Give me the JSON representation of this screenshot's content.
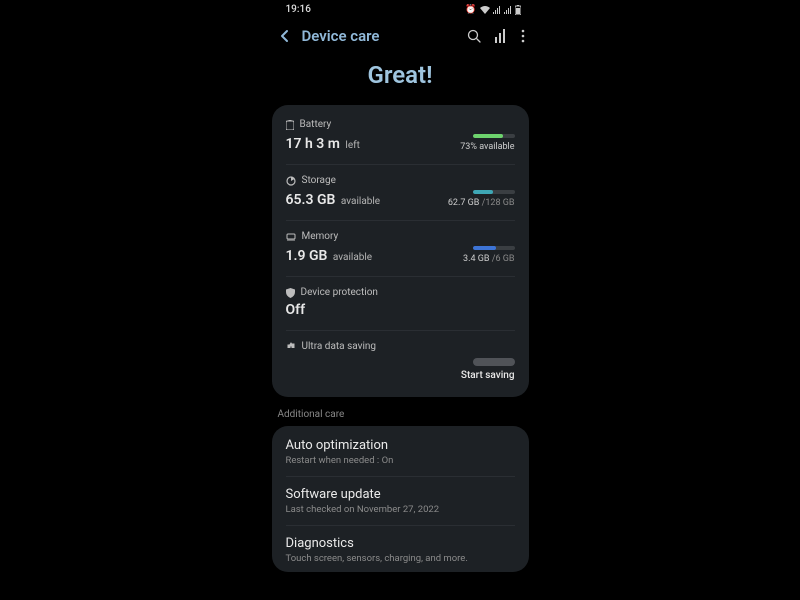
{
  "status": {
    "time": "19:16",
    "icons": [
      "alarm",
      "wifi",
      "signal",
      "signal",
      "battery"
    ]
  },
  "header": {
    "title": "Device care"
  },
  "hero": "Great!",
  "cards": {
    "battery": {
      "label": "Battery",
      "value": "17 h 3 m",
      "value_suffix": "left",
      "right": "73% available",
      "bar_percent": 73,
      "bar_color": "#6dd36d"
    },
    "storage": {
      "label": "Storage",
      "value": "65.3 GB",
      "value_suffix": "available",
      "used": "62.7 GB",
      "total": "/128 GB",
      "bar_percent": 49,
      "bar_color": "#3ea7b5"
    },
    "memory": {
      "label": "Memory",
      "value": "1.9 GB",
      "value_suffix": "available",
      "used": "3.4 GB",
      "total": "/6 GB",
      "bar_percent": 57,
      "bar_color": "#3d74d6"
    },
    "protection": {
      "label": "Device protection",
      "value": "Off"
    },
    "uds": {
      "label": "Ultra data saving",
      "action": "Start saving"
    }
  },
  "section_label": "Additional care",
  "list": {
    "auto_opt": {
      "title": "Auto optimization",
      "sub": "Restart when needed : On"
    },
    "sw_update": {
      "title": "Software update",
      "sub": "Last checked on November 27, 2022"
    },
    "diag": {
      "title": "Diagnostics",
      "sub": "Touch screen, sensors, charging, and more."
    }
  }
}
